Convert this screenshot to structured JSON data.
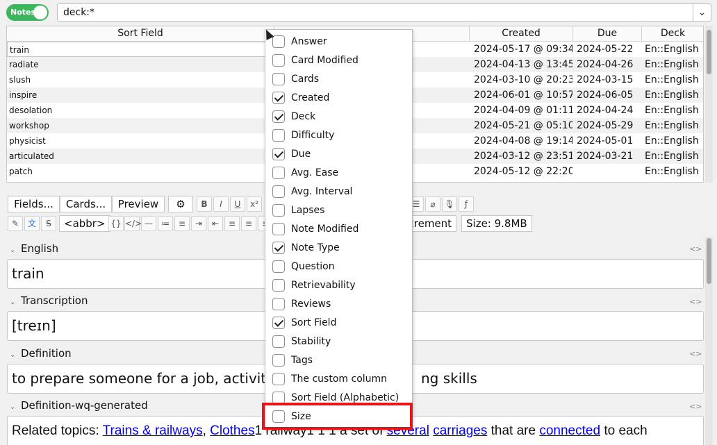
{
  "toggle": {
    "label": "Notes"
  },
  "search": {
    "query": "deck:*"
  },
  "table": {
    "headers": {
      "sort_field": "Sort Field",
      "created": "Created",
      "due": "Due",
      "deck": "Deck"
    },
    "rows": [
      {
        "sort_field": "train",
        "created": "2024-05-17 @ 09:34",
        "due": "2024-05-22",
        "deck": "En::English"
      },
      {
        "sort_field": "radiate",
        "created": "2024-04-13 @ 13:45",
        "due": "2024-04-26",
        "deck": "En::English"
      },
      {
        "sort_field": "slush",
        "created": "2024-03-10 @ 20:23",
        "due": "2024-03-15",
        "deck": "En::English"
      },
      {
        "sort_field": "inspire",
        "created": "2024-06-01 @ 10:57",
        "due": "2024-06-05",
        "deck": "En::English"
      },
      {
        "sort_field": "desolation",
        "created": "2024-04-09 @ 01:11",
        "due": "2024-04-24",
        "deck": "En::English"
      },
      {
        "sort_field": "workshop",
        "created": "2024-05-21 @ 05:10",
        "due": "2024-05-29",
        "deck": "En::English"
      },
      {
        "sort_field": "physicist",
        "created": "2024-04-08 @ 19:14",
        "due": "2024-05-01",
        "deck": "En::English"
      },
      {
        "sort_field": "articulated",
        "created": "2024-03-12 @ 23:51",
        "due": "2024-03-21",
        "deck": "En::English"
      },
      {
        "sort_field": "patch",
        "created": "2024-05-12 @ 22:20",
        "due": "",
        "deck": "En::English"
      }
    ]
  },
  "toolbar": {
    "fields": "Fields...",
    "cards": "Cards...",
    "preview": "Preview",
    "abbr": "<abbr>",
    "increment": "ncrement",
    "size": "Size: 9.8MB"
  },
  "fields": [
    {
      "name": "English",
      "value": "train"
    },
    {
      "name": "Transcription",
      "value": "[treɪn]"
    },
    {
      "name": "Definition",
      "value_left": "to prepare someone for a job, activit",
      "value_right": "ng skills"
    },
    {
      "name": "Definition-wq-generated",
      "value": {
        "prefix": "Related topics: ",
        "link1": "Trains & railways",
        "sep": ", ",
        "link2": "Clothes",
        "mid1": "1 railway1 1 1 a set of ",
        "link3": "several",
        "sp": " ",
        "link4": "carriages",
        "mid2": " that are ",
        "link5": "connected",
        "end": " to each"
      }
    }
  ],
  "code_toggle": "<>",
  "menu": {
    "items": [
      {
        "label": "Answer",
        "checked": false
      },
      {
        "label": "Card Modified",
        "checked": false
      },
      {
        "label": "Cards",
        "checked": false
      },
      {
        "label": "Created",
        "checked": true
      },
      {
        "label": "Deck",
        "checked": true
      },
      {
        "label": "Difficulty",
        "checked": false
      },
      {
        "label": "Due",
        "checked": true
      },
      {
        "label": "Avg. Ease",
        "checked": false
      },
      {
        "label": "Avg. Interval",
        "checked": false
      },
      {
        "label": "Lapses",
        "checked": false
      },
      {
        "label": "Note Modified",
        "checked": false
      },
      {
        "label": "Note Type",
        "checked": true
      },
      {
        "label": "Question",
        "checked": false
      },
      {
        "label": "Retrievability",
        "checked": false
      },
      {
        "label": "Reviews",
        "checked": false
      },
      {
        "label": "Sort Field",
        "checked": true
      },
      {
        "label": "Stability",
        "checked": false
      },
      {
        "label": "Tags",
        "checked": false
      },
      {
        "label": "The custom column",
        "checked": false
      },
      {
        "label": "Sort Field (Alphabetic)",
        "checked": false
      },
      {
        "label": "Size",
        "checked": false
      }
    ]
  },
  "colors": {
    "toggle_on": "#3cb55c",
    "highlight": "#e8141a",
    "link": "#0000ee"
  }
}
